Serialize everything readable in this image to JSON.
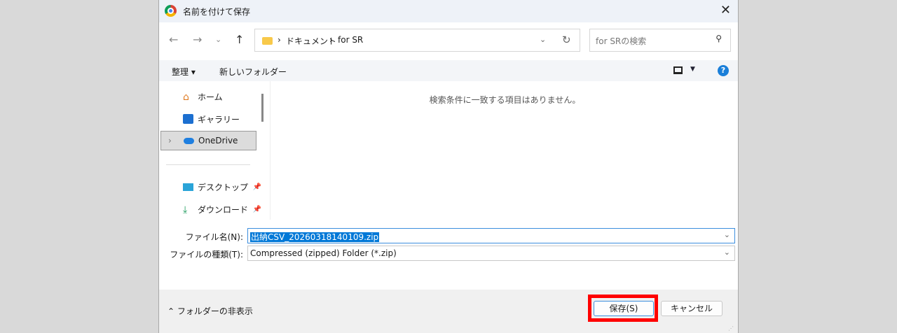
{
  "window": {
    "title": "名前を付けて保存",
    "close": "✕"
  },
  "address": {
    "segments": [
      "ドキュメント",
      "for SR"
    ],
    "sep": "›"
  },
  "search": {
    "placeholder": "for SRの検索"
  },
  "toolbar": {
    "organize": "整理 ▾",
    "new_folder": "新しいフォルダー"
  },
  "nav_items": [
    {
      "label": "ホーム"
    },
    {
      "label": "ギャラリー"
    },
    {
      "label": "OneDrive"
    },
    {
      "label": "デスクトップ"
    },
    {
      "label": "ダウンロード"
    }
  ],
  "content": {
    "empty_message": "検索条件に一致する項目はありません。"
  },
  "form": {
    "filename_label": "ファイル名(N):",
    "filename_value": "出納CSV_20260318140109.zip",
    "filetype_label": "ファイルの種類(T):",
    "filetype_value": "Compressed (zipped) Folder (*.zip)"
  },
  "footer": {
    "hide_folders": "フォルダーの非表示",
    "save": "保存(S)",
    "cancel": "キャンセル"
  },
  "colors": {
    "highlight": "#ff0000",
    "selection": "#0078d7"
  }
}
